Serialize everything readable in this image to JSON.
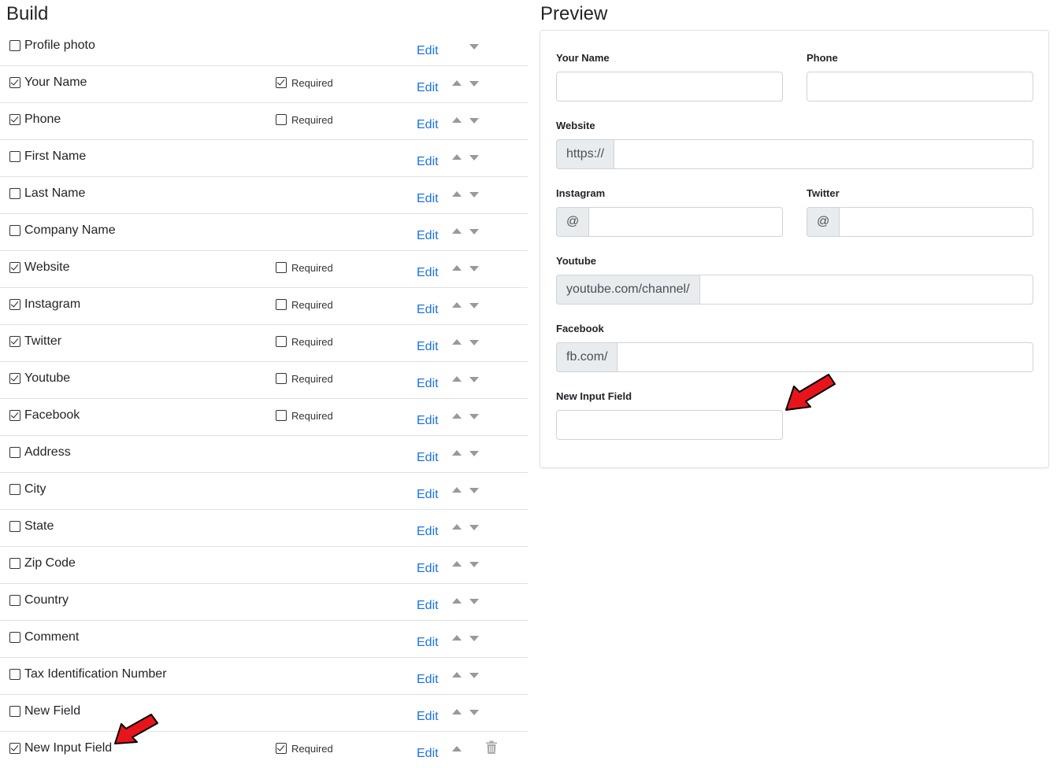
{
  "build": {
    "title": "Build",
    "edit_label": "Edit",
    "required_label": "Required",
    "fields": [
      {
        "label": "Profile photo",
        "checked": false,
        "required": null,
        "up": false,
        "down": true,
        "trash": false
      },
      {
        "label": "Your Name",
        "checked": true,
        "required": true,
        "up": true,
        "down": true,
        "trash": false
      },
      {
        "label": "Phone",
        "checked": true,
        "required": false,
        "up": true,
        "down": true,
        "trash": false
      },
      {
        "label": "First Name",
        "checked": false,
        "required": null,
        "up": true,
        "down": true,
        "trash": false
      },
      {
        "label": "Last Name",
        "checked": false,
        "required": null,
        "up": true,
        "down": true,
        "trash": false
      },
      {
        "label": "Company Name",
        "checked": false,
        "required": null,
        "up": true,
        "down": true,
        "trash": false
      },
      {
        "label": "Website",
        "checked": true,
        "required": false,
        "up": true,
        "down": true,
        "trash": false
      },
      {
        "label": "Instagram",
        "checked": true,
        "required": false,
        "up": true,
        "down": true,
        "trash": false
      },
      {
        "label": "Twitter",
        "checked": true,
        "required": false,
        "up": true,
        "down": true,
        "trash": false
      },
      {
        "label": "Youtube",
        "checked": true,
        "required": false,
        "up": true,
        "down": true,
        "trash": false
      },
      {
        "label": "Facebook",
        "checked": true,
        "required": false,
        "up": true,
        "down": true,
        "trash": false
      },
      {
        "label": "Address",
        "checked": false,
        "required": null,
        "up": true,
        "down": true,
        "trash": false
      },
      {
        "label": "City",
        "checked": false,
        "required": null,
        "up": true,
        "down": true,
        "trash": false
      },
      {
        "label": "State",
        "checked": false,
        "required": null,
        "up": true,
        "down": true,
        "trash": false
      },
      {
        "label": "Zip Code",
        "checked": false,
        "required": null,
        "up": true,
        "down": true,
        "trash": false
      },
      {
        "label": "Country",
        "checked": false,
        "required": null,
        "up": true,
        "down": true,
        "trash": false
      },
      {
        "label": "Comment",
        "checked": false,
        "required": null,
        "up": true,
        "down": true,
        "trash": false
      },
      {
        "label": "Tax Identification Number",
        "checked": false,
        "required": null,
        "up": true,
        "down": true,
        "trash": false
      },
      {
        "label": "New Field",
        "checked": false,
        "required": null,
        "up": true,
        "down": true,
        "trash": false
      },
      {
        "label": "New Input Field",
        "checked": true,
        "required": true,
        "up": true,
        "down": false,
        "trash": true
      }
    ]
  },
  "preview": {
    "title": "Preview",
    "your_name": {
      "label": "Your Name",
      "value": ""
    },
    "phone": {
      "label": "Phone",
      "value": ""
    },
    "website": {
      "label": "Website",
      "prefix": "https://",
      "value": ""
    },
    "instagram": {
      "label": "Instagram",
      "prefix": "@",
      "value": ""
    },
    "twitter": {
      "label": "Twitter",
      "prefix": "@",
      "value": ""
    },
    "youtube": {
      "label": "Youtube",
      "prefix": "youtube.com/channel/",
      "value": ""
    },
    "facebook": {
      "label": "Facebook",
      "prefix": "fb.com/",
      "value": ""
    },
    "new_input_field": {
      "label": "New Input Field",
      "value": ""
    }
  },
  "colors": {
    "link": "#1a73e8",
    "arrow_gray": "#999999",
    "addon_bg": "#e9ecef",
    "annotation_red": "#e8141c"
  },
  "icons": {
    "trash": "trash-icon",
    "annotation": "red-arrow-annotation"
  }
}
